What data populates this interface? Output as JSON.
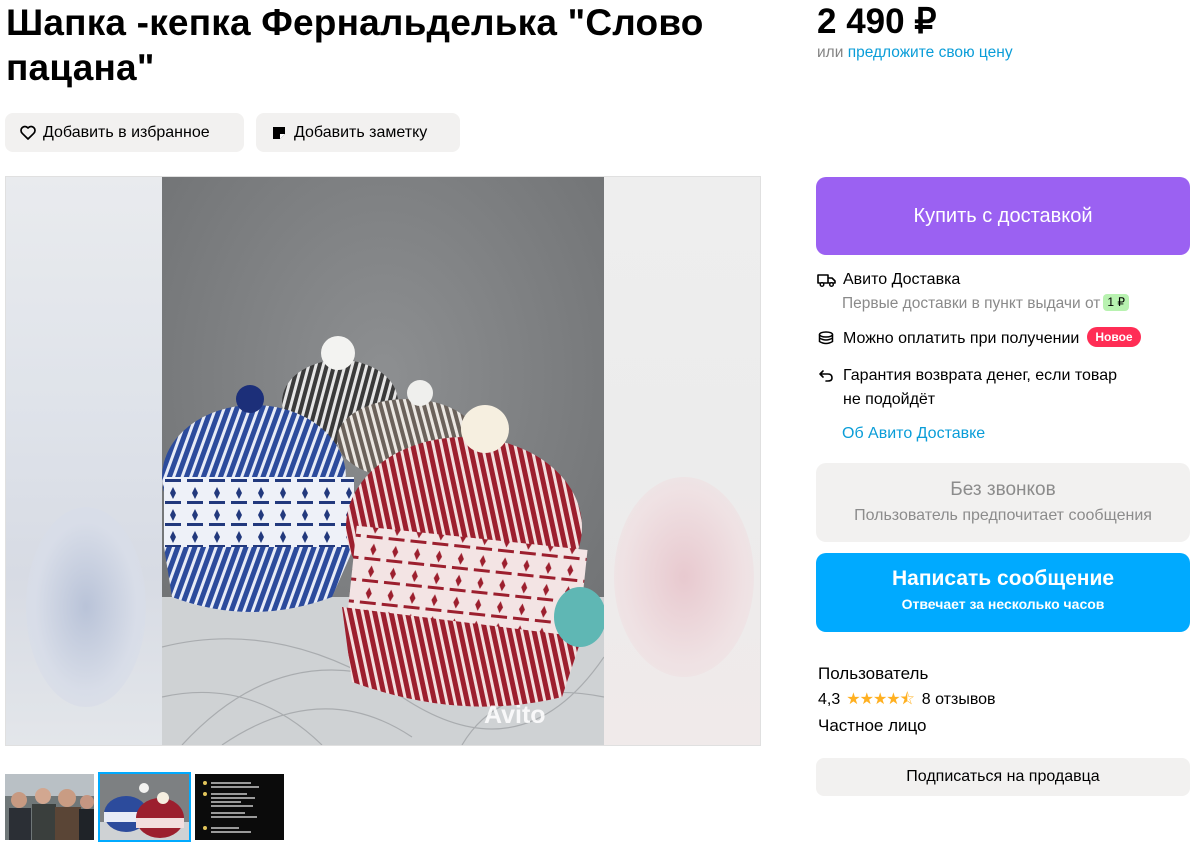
{
  "listing": {
    "title": "Шапка -кепка Фернальделька \"Слово пацана\"",
    "price": "2 490 ₽",
    "price_offer_prefix": "или",
    "price_offer_link": "предложите свою цену"
  },
  "actions": {
    "favorite_label": "Добавить в избранное",
    "note_label": "Добавить заметку"
  },
  "gallery": {
    "watermark": "Avito",
    "thumbnails": [
      "people-photo",
      "hats-photo",
      "text-screenshot"
    ],
    "active_index": 1
  },
  "purchase": {
    "buy_label": "Купить с доставкой",
    "delivery_title": "Авито Доставка",
    "delivery_sub": "Первые доставки в пункт выдачи от",
    "delivery_price": "1 ₽",
    "pay_on_receipt": "Можно оплатить при получении",
    "new_badge": "Новое",
    "guarantee_line1": "Гарантия возврата денег, если товар",
    "guarantee_line2": "не подойдёт",
    "about_link": "Об Авито Доставке"
  },
  "contact": {
    "no_calls_title": "Без звонков",
    "no_calls_sub": "Пользователь предпочитает сообщения",
    "message_title": "Написать сообщение",
    "message_sub": "Отвечает за несколько часов"
  },
  "seller": {
    "label": "Пользователь",
    "rating": "4,3",
    "stars": 4.3,
    "stars_glyph": "★★★★⯪",
    "reviews": "8 отзывов",
    "type": "Частное лицо",
    "subscribe_label": "Подписаться на продавца"
  },
  "colors": {
    "buy_button": "#9b61f2",
    "message_button": "#00aaff",
    "link": "#0a9dd8",
    "new_badge": "#ff2d55",
    "delivery_price_badge": "#b8f2b0"
  }
}
